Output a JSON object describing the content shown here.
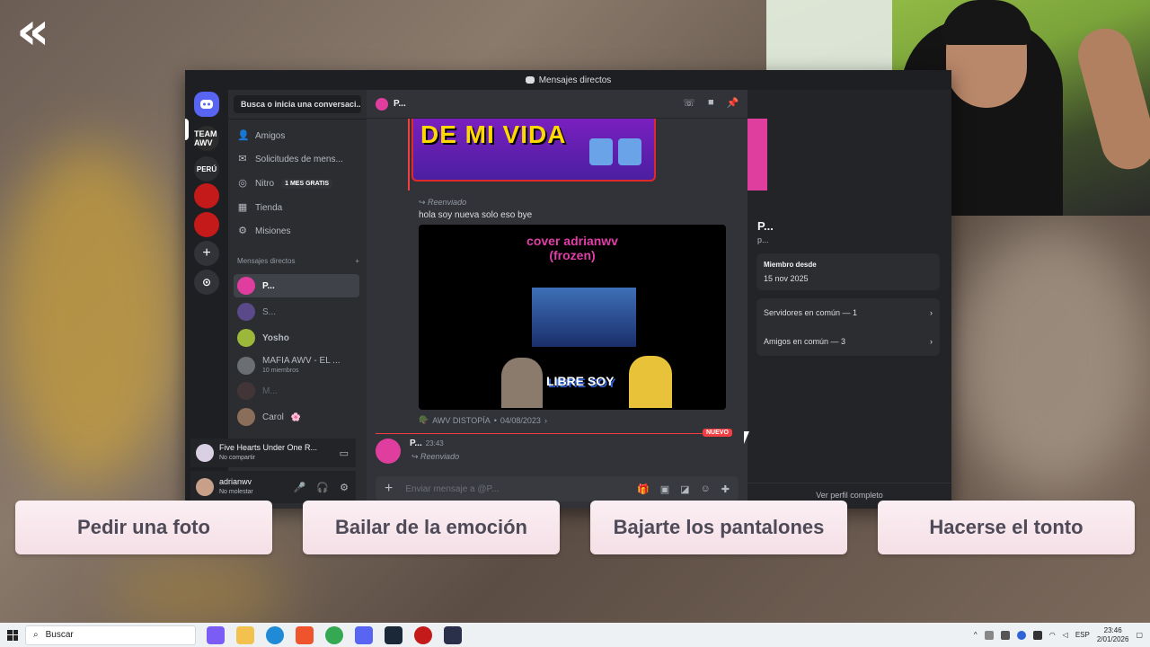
{
  "background": {
    "back_glyph": "«"
  },
  "discord": {
    "window_title": "Mensajes directos",
    "dm_search_placeholder": "Busca o inicia una conversaci...",
    "nav": [
      {
        "label": "Amigos",
        "icon": "friends-icon"
      },
      {
        "label": "Solicitudes de mens...",
        "icon": "mail-icon"
      },
      {
        "label": "Nitro",
        "icon": "nitro-icon",
        "badge": "1 MES GRATIS"
      },
      {
        "label": "Tienda",
        "icon": "shop-icon"
      },
      {
        "label": "Misiones",
        "icon": "quests-icon"
      }
    ],
    "dm_section_label": "Mensajes directos",
    "dm_add_glyph": "+",
    "dms": [
      {
        "name": "P...",
        "sub": "",
        "color": "#e03e9e",
        "active": true
      },
      {
        "name": "S...",
        "sub": "",
        "color": "#5a4a8a",
        "active": false
      },
      {
        "name": "Yosho",
        "sub": "",
        "color": "#9bb83a",
        "active": false
      },
      {
        "name": "MAFIA AWV - EL ...",
        "sub": "10 miembros",
        "color": "#6b6e73",
        "active": false
      },
      {
        "name": "M...",
        "sub": "",
        "color": "#5a3e3e",
        "active": false
      },
      {
        "name": "Carol",
        "sub": "",
        "color": "#8a6e5a",
        "active": false
      }
    ],
    "carol_flower": "🌸",
    "servers": {
      "team": "TEAM AWV",
      "peru": "PERÚ",
      "add": "+",
      "explore": "⊙"
    },
    "now_playing": {
      "title": "Five Hearts Under One R...",
      "sub": "No compartir"
    },
    "user": {
      "name": "adrianwv",
      "status": "No molestar"
    },
    "chat": {
      "recipient": "P...",
      "image_title": "DE MI VIDA",
      "forward_label_1": "Reenviado",
      "message_text": "hola soy nueva solo eso bye",
      "video_caption_1": "cover adrianwv",
      "video_caption_2": "(frozen)",
      "video_overlay": "LIBRE SOY",
      "source_name": "AWV DISTOPÍA",
      "source_date": "04/08/2023",
      "new_label": "NUEVO",
      "author": "P...",
      "time": "23:43",
      "forward_label_2": "Reenviado",
      "composer_placeholder": "Enviar mensaje a @P..."
    },
    "profile": {
      "name": "P...",
      "handle": "p...",
      "member_since_label": "Miembro desde",
      "member_since": "15 nov 2025",
      "mutual_servers": "Servidores en común — 1",
      "mutual_friends": "Amigos en común — 3",
      "view_full": "Ver perfil completo"
    }
  },
  "options": [
    "Pedir una foto",
    "Bailar de la emoción",
    "Bajarte los pantalones",
    "Hacerse el tonto"
  ],
  "taskbar": {
    "search": "Buscar",
    "lang": "ESP",
    "time": "23:46",
    "date": "2/01/2026",
    "apps": [
      "copilot",
      "explorer",
      "edge",
      "brave",
      "chrome",
      "discord",
      "steam",
      "app-red",
      "app-dark"
    ]
  }
}
